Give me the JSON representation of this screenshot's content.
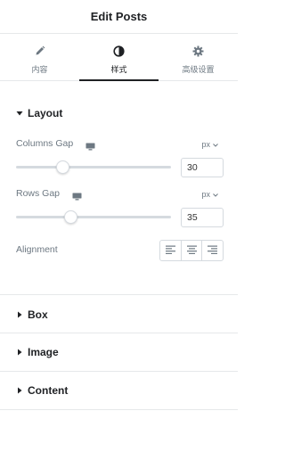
{
  "header": {
    "title": "Edit Posts"
  },
  "tabs": [
    {
      "label": "内容",
      "icon": "pencil-icon",
      "active": false
    },
    {
      "label": "样式",
      "icon": "contrast-icon",
      "active": true
    },
    {
      "label": "高级设置",
      "icon": "gear-icon",
      "active": false
    }
  ],
  "layout": {
    "title": "Layout",
    "expanded": true,
    "columns_gap": {
      "label": "Columns Gap",
      "unit": "px",
      "value": "30",
      "slider_fraction": 0.3
    },
    "rows_gap": {
      "label": "Rows Gap",
      "unit": "px",
      "value": "35",
      "slider_fraction": 0.35
    },
    "alignment": {
      "label": "Alignment",
      "options": [
        "left",
        "center",
        "right"
      ]
    }
  },
  "sections": [
    {
      "title": "Box",
      "expanded": false
    },
    {
      "title": "Image",
      "expanded": false
    },
    {
      "title": "Content",
      "expanded": false
    }
  ],
  "colors": {
    "text_dark": "#1f2124",
    "text_muted": "#6d7882",
    "border": "#d5dadf"
  }
}
